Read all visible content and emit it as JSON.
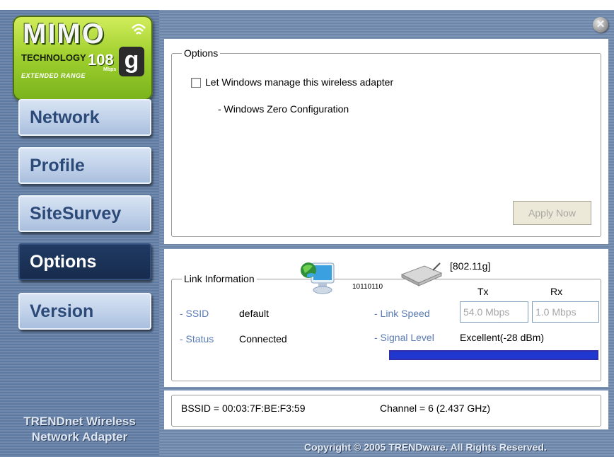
{
  "logo": {
    "brand": "MIMO",
    "technology": "TECHNOLOGY",
    "speed": "108",
    "speed_unit": "Mbps",
    "g": "g",
    "extended": "EXTENDED RANGE"
  },
  "nav": {
    "items": [
      {
        "label": "Network"
      },
      {
        "label": "Profile"
      },
      {
        "label": "SiteSurvey"
      },
      {
        "label": "Options"
      },
      {
        "label": "Version"
      }
    ],
    "active": "Options"
  },
  "brand_text": {
    "line1": "TRENDnet Wireless",
    "line2": "Network Adapter"
  },
  "options": {
    "legend": "Options",
    "checkbox_label": "Let Windows manage this wireless adapter",
    "checkbox_checked": false,
    "sub_label": "- Windows Zero Configuration",
    "apply_button": "Apply Now"
  },
  "link_info": {
    "legend": "Link Information",
    "bits": "10110110",
    "mode": "[802.11g]",
    "tx_header": "Tx",
    "rx_header": "Rx",
    "ssid_label": "- SSID",
    "ssid_value": "default",
    "status_label": "- Status",
    "status_value": "Connected",
    "link_speed_label": "- Link Speed",
    "tx_speed": "54.0 Mbps",
    "rx_speed": "1.0 Mbps",
    "signal_label": "- Signal Level",
    "signal_value": "Excellent(-28 dBm)",
    "signal_fraction": 1.0,
    "signal_color": "#2038d0"
  },
  "bssid": {
    "bssid_text": "BSSID = 00:03:7F:BE:F3:59",
    "channel_text": "Channel = 6 (2.437 GHz)"
  },
  "footer": {
    "copyright": "Copyright © 2005 TRENDware. All Rights Reserved."
  },
  "icons": {
    "close": "close-icon",
    "computer": "computer-icon",
    "router": "router-icon",
    "wifi": "wifi-signal-icon"
  }
}
